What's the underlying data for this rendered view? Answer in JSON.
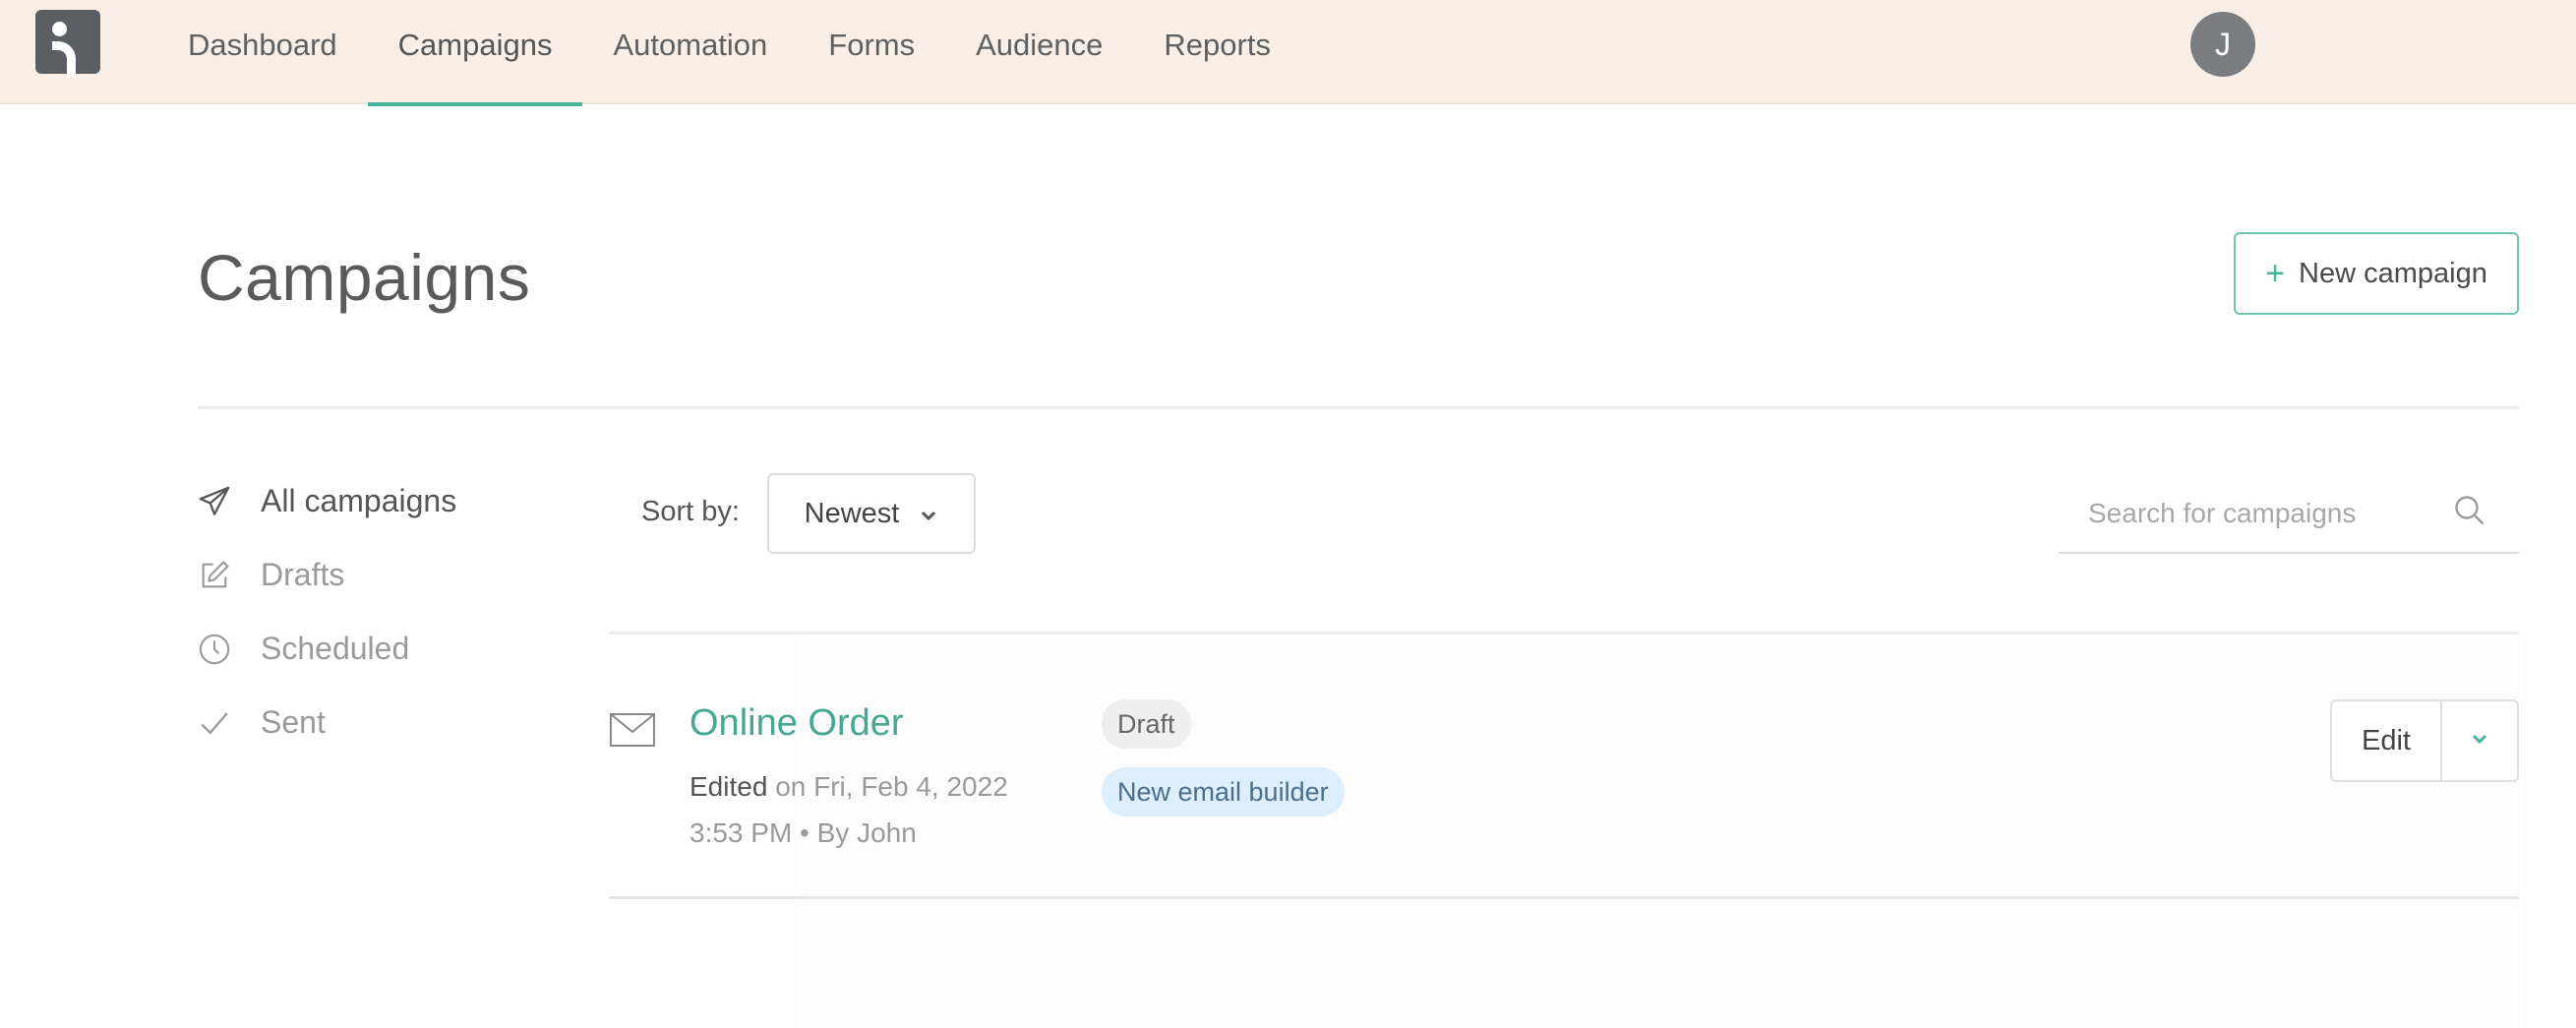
{
  "nav": {
    "items": [
      {
        "label": "Dashboard"
      },
      {
        "label": "Campaigns",
        "active": true
      },
      {
        "label": "Automation"
      },
      {
        "label": "Forms"
      },
      {
        "label": "Audience"
      },
      {
        "label": "Reports"
      }
    ],
    "avatar_initial": "J"
  },
  "header": {
    "title": "Campaigns",
    "new_button_label": "New campaign"
  },
  "sidebar": {
    "items": [
      {
        "label": "All campaigns",
        "icon": "paper-plane-icon",
        "active": true
      },
      {
        "label": "Drafts",
        "icon": "pencil-square-icon"
      },
      {
        "label": "Scheduled",
        "icon": "clock-icon"
      },
      {
        "label": "Sent",
        "icon": "check-icon"
      }
    ]
  },
  "toolbar": {
    "sort_label": "Sort by:",
    "sort_value": "Newest",
    "search_placeholder": "Search for campaigns"
  },
  "campaigns": [
    {
      "name": "Online Order",
      "edited_label": "Edited",
      "edited_detail": "on Fri, Feb 4, 2022 3:53 PM • By John",
      "status_badge": "Draft",
      "builder_badge": "New email builder",
      "edit_label": "Edit"
    }
  ],
  "colors": {
    "accent": "#45b49b",
    "topbar_bg": "#faefe6",
    "link": "#45a895",
    "builder_badge_bg": "#ddeefc"
  }
}
